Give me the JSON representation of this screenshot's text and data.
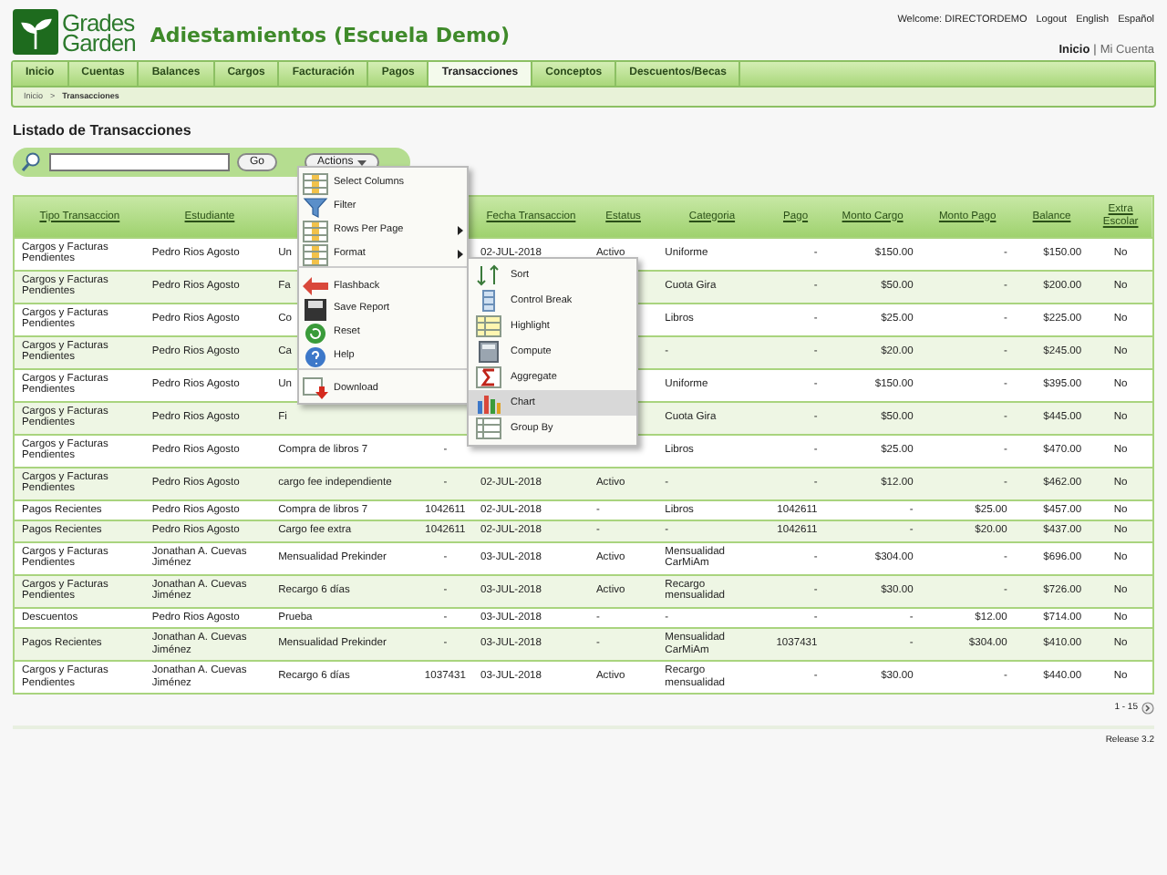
{
  "header": {
    "logo": {
      "line1": "Grades",
      "line2": "Garden"
    },
    "title": "Adiestamientos (Escuela Demo)",
    "user_links": [
      "Welcome: DIRECTORDEMO",
      "Logout",
      "English",
      "Español"
    ],
    "account_links": [
      {
        "label": "Inicio",
        "selected": true
      },
      {
        "label": "Mi Cuenta",
        "selected": false
      }
    ],
    "account_separator": "|"
  },
  "nav": [
    {
      "label": "Inicio",
      "selected": false
    },
    {
      "label": "Cuentas",
      "selected": false
    },
    {
      "label": "Balances",
      "selected": false
    },
    {
      "label": "Cargos",
      "selected": false
    },
    {
      "label": "Facturación",
      "selected": false
    },
    {
      "label": "Pagos",
      "selected": false
    },
    {
      "label": "Transacciones",
      "selected": true
    },
    {
      "label": "Conceptos",
      "selected": false
    },
    {
      "label": "Descuentos/Becas",
      "selected": false
    }
  ],
  "breadcrumb": {
    "items": [
      "Inicio",
      "Transacciones"
    ],
    "separator": ">"
  },
  "page_title": "Listado de Transacciones",
  "toolbar": {
    "go_button": "Go",
    "actions_button": "Actions"
  },
  "actions_menu": [
    {
      "label": "Select Columns",
      "has_submenu": false,
      "separator_before": false
    },
    {
      "label": "Filter",
      "has_submenu": false,
      "separator_before": false
    },
    {
      "label": "Rows Per Page",
      "has_submenu": true,
      "separator_before": false
    },
    {
      "label": "Format",
      "has_submenu": true,
      "separator_before": false
    },
    {
      "label": "Flashback",
      "has_submenu": false,
      "separator_before": true
    },
    {
      "label": "Save Report",
      "has_submenu": false,
      "separator_before": false
    },
    {
      "label": "Reset",
      "has_submenu": false,
      "separator_before": false
    },
    {
      "label": "Help",
      "has_submenu": false,
      "separator_before": false
    },
    {
      "label": "Download",
      "has_submenu": false,
      "separator_before": true
    }
  ],
  "format_submenu": [
    {
      "label": "Sort",
      "selected": false
    },
    {
      "label": "Control Break",
      "selected": false
    },
    {
      "label": "Highlight",
      "selected": false
    },
    {
      "label": "Compute",
      "selected": false
    },
    {
      "label": "Aggregate",
      "selected": false
    },
    {
      "label": "Chart",
      "selected": true
    },
    {
      "label": "Group By",
      "selected": false
    }
  ],
  "table": {
    "columns": [
      {
        "label": "Tipo Transaccion"
      },
      {
        "label": "Estudiante"
      },
      {},
      {},
      {
        "label": "Fecha Transaccion"
      },
      {
        "label": "Estatus"
      },
      {
        "label": "Categoria"
      },
      {
        "label": "Pago"
      },
      {
        "label": "Monto Cargo"
      },
      {
        "label": "Monto Pago"
      },
      {
        "label": "Balance"
      },
      {
        "label": "Extra Escolar"
      }
    ],
    "rows": [
      {
        "cells": [
          "Cargos y Facturas Pendientes",
          "Pedro Rios Agosto",
          "Un",
          null,
          "02-JUL-2018",
          "Activo",
          "Uniforme",
          "-",
          "$150.00",
          "-",
          "$150.00",
          "No"
        ]
      },
      {
        "cells": [
          "Cargos y Facturas Pendientes",
          "Pedro Rios Agosto",
          "Fa",
          null,
          null,
          null,
          "Cuota Gira",
          "-",
          "$50.00",
          "-",
          "$200.00",
          "No"
        ]
      },
      {
        "cells": [
          "Cargos y Facturas Pendientes",
          "Pedro Rios Agosto",
          "Co",
          null,
          null,
          null,
          "Libros",
          "-",
          "$25.00",
          "-",
          "$225.00",
          "No"
        ]
      },
      {
        "cells": [
          "Cargos y Facturas Pendientes",
          "Pedro Rios Agosto",
          "Ca",
          null,
          null,
          null,
          "-",
          "-",
          "$20.00",
          "-",
          "$245.00",
          "No"
        ]
      },
      {
        "cells": [
          "Cargos y Facturas Pendientes",
          "Pedro Rios Agosto",
          "Un",
          null,
          null,
          null,
          "Uniforme",
          "-",
          "$150.00",
          "-",
          "$395.00",
          "No"
        ]
      },
      {
        "cells": [
          "Cargos y Facturas Pendientes",
          "Pedro Rios Agosto",
          "Fi",
          null,
          null,
          null,
          "Cuota Gira",
          "-",
          "$50.00",
          "-",
          "$445.00",
          "No"
        ]
      },
      {
        "cells": [
          "Cargos y Facturas Pendientes",
          "Pedro Rios Agosto",
          "Compra de libros 7",
          "-",
          null,
          null,
          "Libros",
          "-",
          "$25.00",
          "-",
          "$470.00",
          "No"
        ]
      },
      {
        "cells": [
          "Cargos y Facturas Pendientes",
          "Pedro Rios Agosto",
          "cargo fee independiente",
          "-",
          "02-JUL-2018",
          "Activo",
          "-",
          "-",
          "$12.00",
          "-",
          "$462.00",
          "No"
        ]
      },
      {
        "cells": [
          "Pagos Recientes",
          "Pedro Rios Agosto",
          "Compra de libros 7",
          "1042611",
          "02-JUL-2018",
          "-",
          "Libros",
          "1042611",
          "-",
          "$25.00",
          "$457.00",
          "No"
        ]
      },
      {
        "cells": [
          "Pagos Recientes",
          "Pedro Rios Agosto",
          "Cargo fee extra",
          "1042611",
          "02-JUL-2018",
          "-",
          "-",
          "1042611",
          "-",
          "$20.00",
          "$437.00",
          "No"
        ]
      },
      {
        "cells": [
          "Cargos y Facturas Pendientes",
          "Jonathan A. Cuevas Jiménez",
          "Mensualidad Prekinder",
          "-",
          "03-JUL-2018",
          "Activo",
          "Mensualidad CarMiAm",
          "-",
          "$304.00",
          "-",
          "$696.00",
          "No"
        ]
      },
      {
        "cells": [
          "Cargos y Facturas Pendientes",
          "Jonathan A. Cuevas Jiménez",
          "Recargo 6 días",
          "-",
          "03-JUL-2018",
          "Activo",
          "Recargo mensualidad",
          "-",
          "$30.00",
          "-",
          "$726.00",
          "No"
        ]
      },
      {
        "cells": [
          "Descuentos",
          "Pedro Rios Agosto",
          "Prueba",
          "-",
          "03-JUL-2018",
          "-",
          "-",
          "-",
          "-",
          "$12.00",
          "$714.00",
          "No"
        ]
      },
      {
        "cells": [
          "Pagos Recientes",
          "Jonathan A. Cuevas Jiménez",
          "Mensualidad Prekinder",
          "-",
          "03-JUL-2018",
          "-",
          "Mensualidad CarMiAm",
          "1037431",
          "-",
          "$304.00",
          "$410.00",
          "No"
        ]
      },
      {
        "cells": [
          "Cargos y Facturas Pendientes",
          "Jonathan A. Cuevas Jiménez",
          "Recargo 6 días",
          "1037431",
          "03-JUL-2018",
          "Activo",
          "Recargo mensualidad",
          "-",
          "$30.00",
          "-",
          "$440.00",
          "No"
        ]
      }
    ]
  },
  "pagination": "1 - 15",
  "release": "Release 3.2"
}
